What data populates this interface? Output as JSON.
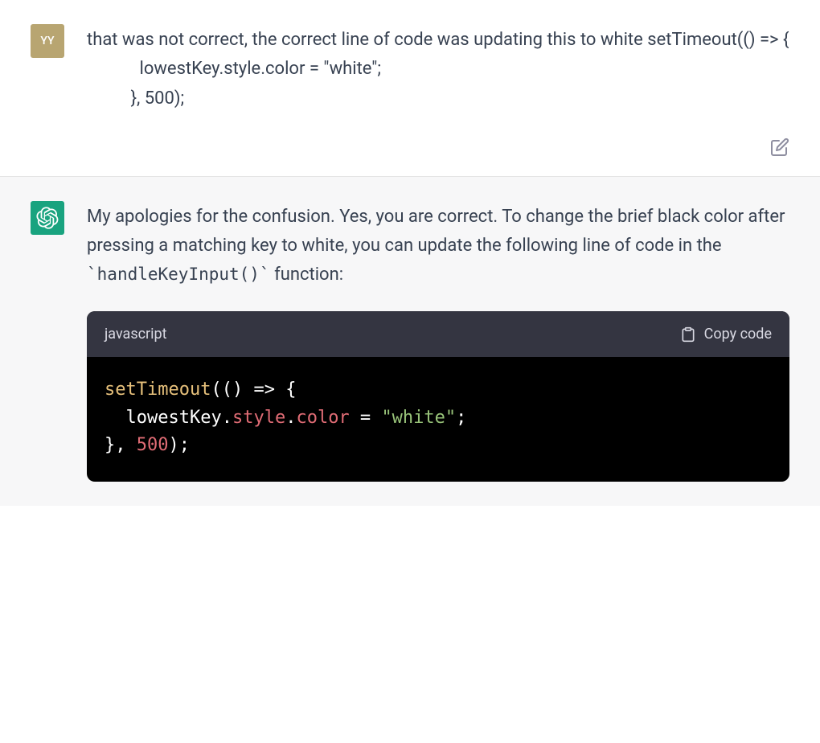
{
  "user": {
    "avatar_initials": "YY",
    "message": "that was not correct, the correct line of code was updating this to white setTimeout(() => {\n            lowestKey.style.color = \"white\";\n          }, 500);"
  },
  "assistant": {
    "response_prefix": "My apologies for the confusion. Yes, you are correct. To change the brief black color after pressing a matching key to white, you can update the following line of code in the ",
    "inline_code": "handleKeyInput()",
    "response_suffix": " function:",
    "code_block": {
      "language": "javascript",
      "copy_label": "Copy code",
      "tokens": {
        "fn": "setTimeout",
        "paren_open": "(",
        "arrow_params": "() ",
        "arrow": "=> ",
        "brace_open": "{",
        "indent": "  ",
        "obj": "lowestKey",
        "dot1": ".",
        "prop1": "style",
        "dot2": ".",
        "prop2": "color",
        "eq": " = ",
        "str": "\"white\"",
        "semi1": ";",
        "brace_close": "}, ",
        "num": "500",
        "paren_close": ")",
        "semi2": ";"
      }
    }
  }
}
